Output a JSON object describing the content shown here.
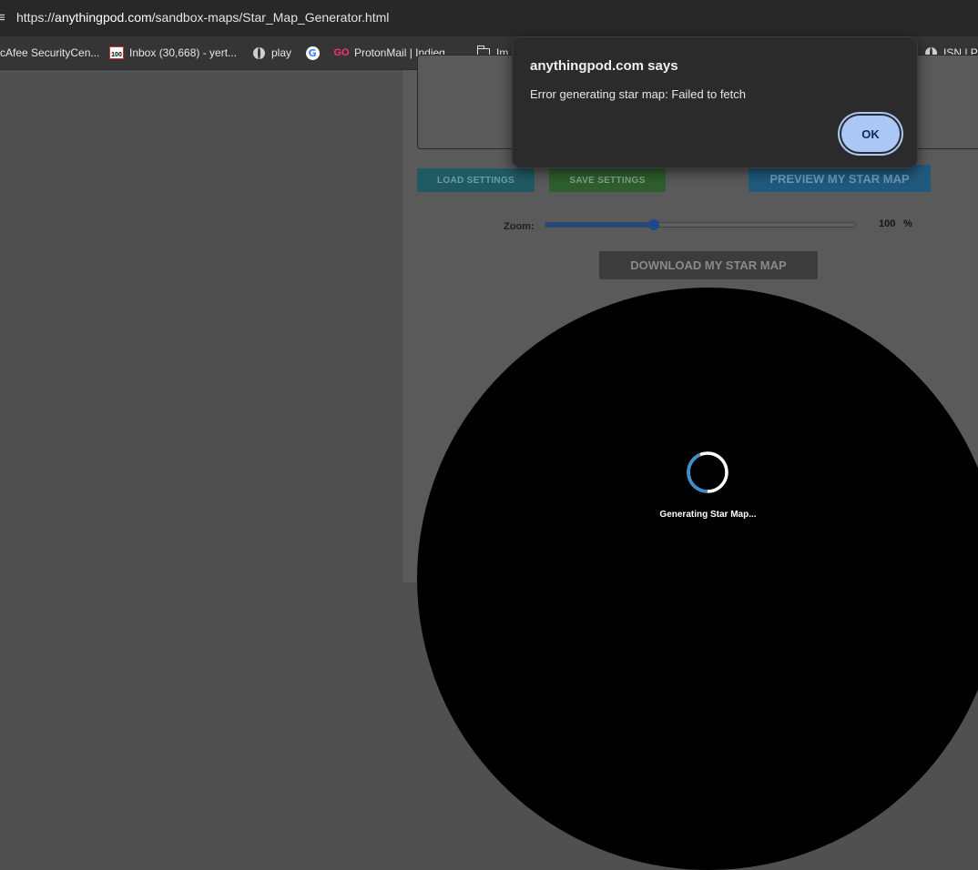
{
  "browser": {
    "url_prefix": "https://",
    "url_host": "anythingpod.com",
    "url_path": "/sandbox-maps/Star_Map_Generator.html",
    "bookmarks": [
      {
        "label": "cAfee SecurityCen...",
        "icon": "none"
      },
      {
        "label": "Inbox (30,668) - yert...",
        "icon": "gmail-icon"
      },
      {
        "label": "play",
        "icon": "globe-icon"
      },
      {
        "label": "",
        "icon": "google-icon"
      },
      {
        "label": "ProtonMail | Indieg...",
        "icon": "go-icon"
      },
      {
        "label": "Im",
        "icon": "folder-icon"
      },
      {
        "label": "ISN | Pu",
        "icon": "globe-icon"
      }
    ]
  },
  "page": {
    "load_settings": "LOAD SETTINGS",
    "save_settings": "SAVE SETTINGS",
    "preview": "PREVIEW MY STAR MAP",
    "zoom_label": "Zoom:",
    "zoom_value": "100",
    "zoom_unit": "%",
    "zoom_fraction": 0.35,
    "download": "DOWNLOAD MY STAR MAP",
    "generating": "Generating Star Map..."
  },
  "dialog": {
    "title": "anythingpod.com says",
    "message": "Error generating star map: Failed to fetch",
    "ok": "OK"
  }
}
